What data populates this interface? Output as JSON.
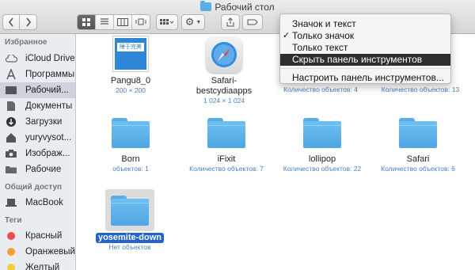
{
  "window": {
    "title": "Рабочий стол"
  },
  "toolbar": {
    "back_icon": "chevron-left-icon",
    "forward_icon": "chevron-right-icon",
    "view_modes": [
      "icon-view-icon",
      "list-view-icon",
      "column-view-icon",
      "coverflow-view-icon"
    ],
    "arrange_icon": "arrange-grid-icon",
    "action_icon": "gear-icon",
    "share_icon": "share-icon",
    "tag_icon": "tag-icon"
  },
  "menu": {
    "items": [
      {
        "label": "Значок и текст",
        "checked": false
      },
      {
        "label": "Только значок",
        "checked": true
      },
      {
        "label": "Только текст",
        "checked": false
      },
      {
        "label": "Скрыть панель инструментов",
        "highlighted": true
      }
    ],
    "customize_label": "Настроить панель инструментов...",
    "check_mark": "✓"
  },
  "sidebar": {
    "favorites_header": "Избранное",
    "favorites": [
      {
        "label": "iCloud Drive",
        "icon": "cloud-icon"
      },
      {
        "label": "Программы",
        "icon": "apps-icon"
      },
      {
        "label": "Рабочий...",
        "icon": "desktop-icon",
        "selected": true
      },
      {
        "label": "Документы",
        "icon": "documents-icon"
      },
      {
        "label": "Загрузки",
        "icon": "downloads-icon"
      },
      {
        "label": "yuryvysot...",
        "icon": "home-icon"
      },
      {
        "label": "Изображ...",
        "icon": "camera-icon"
      },
      {
        "label": "Рабочие",
        "icon": "folder-icon"
      }
    ],
    "shared_header": "Общий доступ",
    "shared": [
      {
        "label": "MacBook",
        "icon": "laptop-icon"
      }
    ],
    "tags_header": "Теги",
    "tags": [
      {
        "label": "Красный",
        "color": "#f14c4c"
      },
      {
        "label": "Оранжевый",
        "color": "#f5a030"
      },
      {
        "label": "Желтый",
        "color": "#f0d030"
      }
    ]
  },
  "items": [
    {
      "name": "Pangu8_0",
      "info": "200 × 200",
      "type": "image"
    },
    {
      "name": "Safari-",
      "name2": "bestcydiaapps",
      "info": "1 024 × 1 024",
      "type": "safari"
    },
    {
      "name": "",
      "info": "Количество объектов: 4",
      "type": "hidden"
    },
    {
      "name": "",
      "info": "Количество объектов: 13",
      "type": "hidden"
    },
    {
      "name": "Born",
      "info": "объектов: 1",
      "type": "folder"
    },
    {
      "name": "iFixit",
      "info": "Количество объектов: 7",
      "type": "folder"
    },
    {
      "name": "lollipop",
      "info": "Количество объектов: 22",
      "type": "folder"
    },
    {
      "name": "Safari",
      "info": "Количество объектов: 6",
      "type": "folder"
    },
    {
      "name": "yosemite-down",
      "info": "Нет объектов",
      "type": "folder",
      "selected": true
    }
  ],
  "pangu_badge": "睡于完美",
  "colors": {
    "selection": "#2463cd",
    "folder": "#5aaee8",
    "info_text": "#4a7fc6"
  }
}
